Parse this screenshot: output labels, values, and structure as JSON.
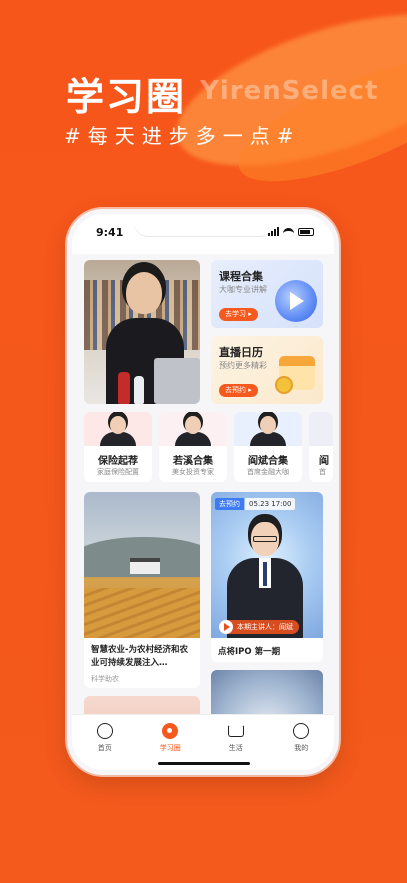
{
  "promo": {
    "title": "学习圈",
    "title_en": "YirenSelect",
    "subtitle": "#每天进步多一点#"
  },
  "status_bar": {
    "time": "9:41"
  },
  "feature_cards": [
    {
      "title": "课程合集",
      "subtitle": "大咖专业讲解",
      "button": "去学习 ▸"
    },
    {
      "title": "直播日历",
      "subtitle": "预约更多精彩",
      "button": "去预约 ▸"
    }
  ],
  "experts": [
    {
      "name": "保险起荐",
      "desc": "家庭保险配置"
    },
    {
      "name": "若溪合集",
      "desc": "美女投资专家"
    },
    {
      "name": "阎斌合集",
      "desc": "首席金融大咖"
    },
    {
      "name": "阎",
      "desc": "首"
    }
  ],
  "feed": {
    "left": {
      "title": "智慧农业-为农村经济和农业可持续发展注入…",
      "author": "科学助农"
    },
    "right": {
      "tag": "去预约",
      "date": "05.23 17:00",
      "speaker": "本期主讲人：阎斌",
      "title": "点将IPO 第一期"
    }
  },
  "tabbar": [
    {
      "label": "首页",
      "icon": "home-icon"
    },
    {
      "label": "学习圈",
      "icon": "learning-circle-icon"
    },
    {
      "label": "生活",
      "icon": "crown-icon"
    },
    {
      "label": "我的",
      "icon": "profile-icon"
    }
  ],
  "colors": {
    "brand": "#f6591d",
    "accent_blue": "#3f7bf2"
  }
}
